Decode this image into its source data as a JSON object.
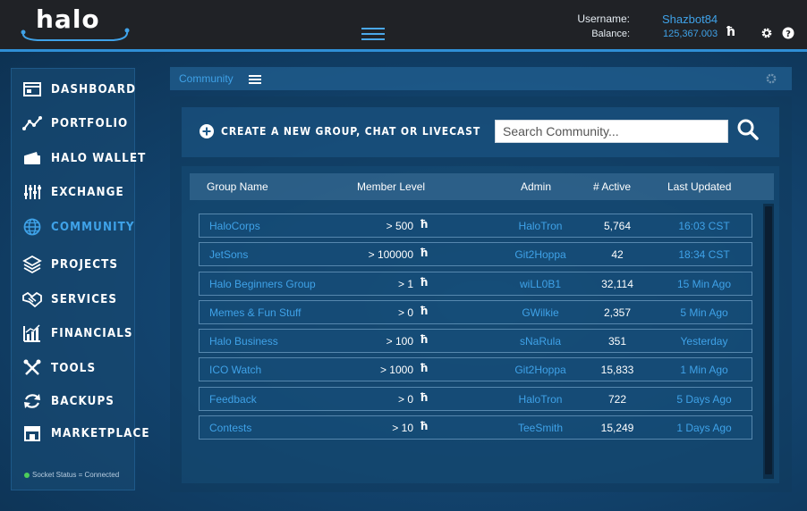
{
  "header": {
    "logo_text": "halo",
    "username_label": "Username:",
    "username": "Shazbot84",
    "balance_label": "Balance:",
    "balance": "125,367.003",
    "currency_symbol": "ħ",
    "settings_icon": "gear-icon",
    "help_icon": "help-icon",
    "menu_icon": "hamburger-menu-icon"
  },
  "sidebar": {
    "items": [
      {
        "label": "DASHBOARD",
        "icon": "dashboard-icon"
      },
      {
        "label": "PORTFOLIO",
        "icon": "portfolio-chart-icon"
      },
      {
        "label": "HALO WALLET",
        "icon": "wallet-icon"
      },
      {
        "label": "EXCHANGE",
        "icon": "sliders-icon"
      },
      {
        "label": "COMMUNITY",
        "icon": "globe-icon",
        "active": true
      },
      {
        "label": "PROJECTS",
        "icon": "layers-icon"
      },
      {
        "label": "SERVICES",
        "icon": "handshake-icon"
      },
      {
        "label": "FINANCIALS",
        "icon": "bar-chart-icon"
      },
      {
        "label": "TOOLS",
        "icon": "tools-icon"
      },
      {
        "label": "BACKUPS",
        "icon": "sync-icon"
      },
      {
        "label": "MARKETPLACE",
        "icon": "store-icon"
      }
    ],
    "socket_status": "Socket Status = Connected",
    "socket_color": "#4ccd5a"
  },
  "breadcrumb": {
    "label": "Community"
  },
  "community": {
    "create_label": "CREATE A NEW GROUP, CHAT OR LIVECAST",
    "search_placeholder": "Search Community...",
    "columns": [
      "Group Name",
      "Member Level",
      "Admin",
      "# Active",
      "Last Updated"
    ],
    "rows": [
      {
        "name": "HaloCorps",
        "level": "> 500",
        "admin": "HaloTron",
        "active": "5,764",
        "updated": "16:03 CST"
      },
      {
        "name": "JetSons",
        "level": "> 100000",
        "admin": "Git2Hoppa",
        "active": "42",
        "updated": "18:34 CST"
      },
      {
        "name": "Halo Beginners Group",
        "level": "> 1",
        "admin": "wiLL0B1",
        "active": "32,114",
        "updated": "15 Min Ago"
      },
      {
        "name": "Memes & Fun Stuff",
        "level": "> 0",
        "admin": "GWilkie",
        "active": "2,357",
        "updated": "5 Min Ago"
      },
      {
        "name": "Halo Business",
        "level": "> 100",
        "admin": "sNaRula",
        "active": "351",
        "updated": "Yesterday"
      },
      {
        "name": "ICO Watch",
        "level": "> 1000",
        "admin": "Git2Hoppa",
        "active": "15,833",
        "updated": "1 Min Ago"
      },
      {
        "name": "Feedback",
        "level": "> 0",
        "admin": "HaloTron",
        "active": "722",
        "updated": "5 Days Ago"
      },
      {
        "name": "Contests",
        "level": "> 10",
        "admin": "TeeSmith",
        "active": "15,249",
        "updated": "1 Days Ago"
      }
    ]
  },
  "colors": {
    "accent": "#3fa2e8",
    "topbar": "#202226",
    "background": "#0f3556"
  }
}
